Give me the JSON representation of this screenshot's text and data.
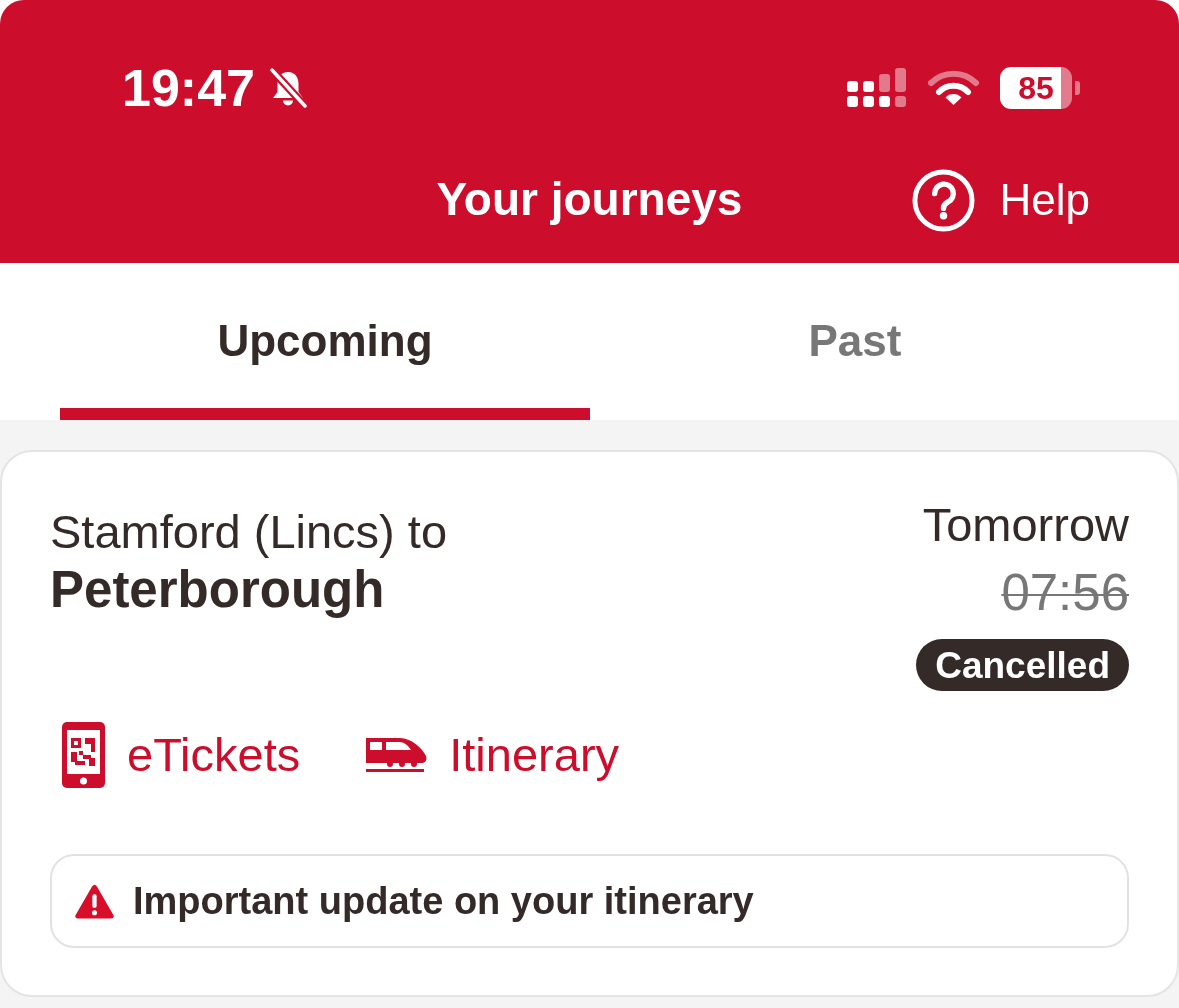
{
  "status_bar": {
    "time": "19:47",
    "silent": true,
    "battery": "85"
  },
  "header": {
    "title": "Your journeys",
    "help": "Help"
  },
  "tabs": [
    {
      "label": "Upcoming",
      "selected": true
    },
    {
      "label": "Past",
      "selected": false
    }
  ],
  "journeys": [
    {
      "origin": "Stamford (Lincs) to",
      "destination": "Peterborough",
      "day": "Tomorrow",
      "time": "07:56",
      "cancelled": true,
      "status": "Cancelled",
      "actions": [
        {
          "kind": "etickets",
          "label": "eTickets"
        },
        {
          "kind": "itinerary",
          "label": "Itinerary"
        }
      ],
      "alert": "Important update on your itinerary"
    }
  ]
}
